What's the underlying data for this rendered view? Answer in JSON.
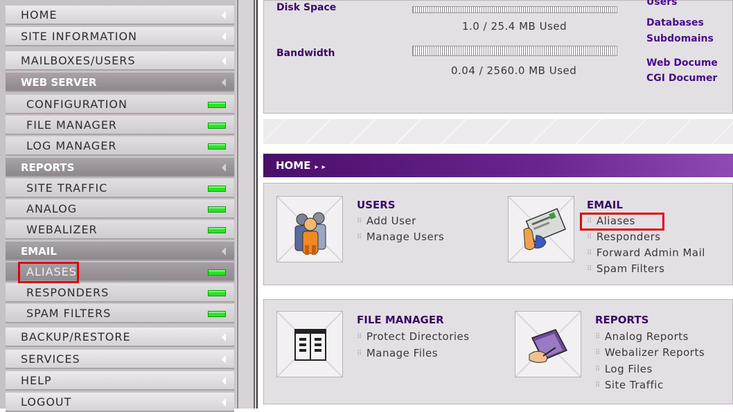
{
  "sidebar": {
    "items": [
      {
        "label": "HOME",
        "kind": "top"
      },
      {
        "label": "SITE INFORMATION",
        "kind": "top"
      },
      {
        "label": "MAILBOXES/USERS",
        "kind": "top"
      },
      {
        "label": "WEB SERVER",
        "kind": "section"
      },
      {
        "label": "CONFIGURATION",
        "kind": "sub"
      },
      {
        "label": "FILE MANAGER",
        "kind": "sub"
      },
      {
        "label": "LOG MANAGER",
        "kind": "sub"
      },
      {
        "label": "REPORTS",
        "kind": "section"
      },
      {
        "label": "SITE TRAFFIC",
        "kind": "sub"
      },
      {
        "label": "ANALOG",
        "kind": "sub"
      },
      {
        "label": "WEBALIZER",
        "kind": "sub"
      },
      {
        "label": "EMAIL",
        "kind": "section"
      },
      {
        "label": "ALIASES",
        "kind": "sub",
        "active": true
      },
      {
        "label": "RESPONDERS",
        "kind": "sub"
      },
      {
        "label": "SPAM FILTERS",
        "kind": "sub"
      },
      {
        "label": "BACKUP/RESTORE",
        "kind": "top"
      },
      {
        "label": "SERVICES",
        "kind": "top"
      },
      {
        "label": "HELP",
        "kind": "top"
      },
      {
        "label": "LOGOUT",
        "kind": "top"
      }
    ]
  },
  "usage": {
    "disk_label": "Disk Space",
    "disk_value": "1.0 / 25.4 MB Used",
    "bandwidth_label": "Bandwidth",
    "bandwidth_value": "0.04 / 2560.0 MB Used",
    "links": [
      "Users",
      "Databases",
      "Subdomains",
      "Web Docume",
      "CGI Documer"
    ]
  },
  "home_bar": {
    "title": "HOME",
    "arrows": "▸ ▸"
  },
  "quick": {
    "users": {
      "title": "USERS",
      "links": [
        "Add User",
        "Manage Users"
      ]
    },
    "email": {
      "title": "EMAIL",
      "links": [
        "Aliases",
        "Responders",
        "Forward Admin Mail",
        "Spam Filters"
      ]
    },
    "file_manager": {
      "title": "FILE MANAGER",
      "links": [
        "Protect Directories",
        "Manage Files"
      ]
    },
    "reports": {
      "title": "REPORTS",
      "links": [
        "Analog Reports",
        "Webalizer Reports",
        "Log Files",
        "Site Traffic"
      ]
    }
  },
  "colors": {
    "accent_purple": "#5a1a80",
    "led_green": "#28e428",
    "highlight_red": "#e00000"
  }
}
